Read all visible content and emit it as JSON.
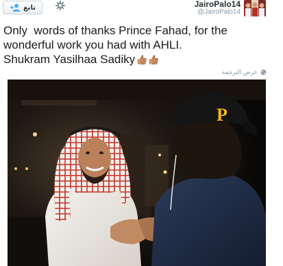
{
  "header": {
    "follow_label": "تابع",
    "display_name": "JairoPalo14",
    "handle": "@JairoPalo14"
  },
  "tweet": {
    "text": "Only  words of thanks Prince Fahad, for the wonderful work you had with AHLI.\nShukram Yasilhaa Sadiky",
    "emojis": [
      "thumbs-up-emoji",
      "thumbs-up-emoji"
    ]
  },
  "translate": {
    "label": "عرض الترجمة"
  },
  "colors": {
    "text": "#1a1a1a",
    "muted": "#8899a6",
    "follow_border": "#c9d3da",
    "cap_logo": "#f2b61b"
  }
}
